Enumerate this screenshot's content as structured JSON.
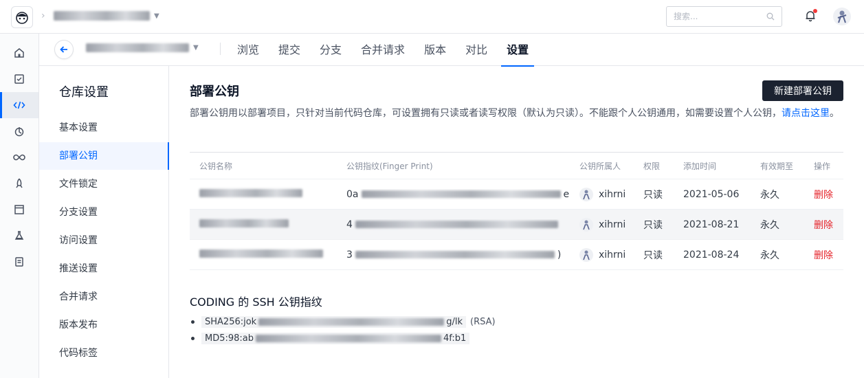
{
  "topbar": {
    "search_placeholder": "搜索...",
    "icons": {
      "logo": "coding-logo-icon",
      "search": "search-icon",
      "bell": "bell-icon"
    }
  },
  "leftnav": {
    "items": [
      "home-icon",
      "task-icon",
      "code-icon",
      "pipeline-icon",
      "infinity-icon",
      "deploy-icon",
      "artifact-icon",
      "test-icon",
      "wiki-icon"
    ]
  },
  "repo": {
    "tabs": [
      "浏览",
      "提交",
      "分支",
      "合并请求",
      "版本",
      "对比",
      "设置"
    ],
    "active_tab": "设置"
  },
  "settings_sidebar": {
    "title": "仓库设置",
    "items": [
      "基本设置",
      "部署公钥",
      "文件锁定",
      "分支设置",
      "访问设置",
      "推送设置",
      "合并请求",
      "版本发布",
      "代码标签"
    ],
    "active": "部署公钥"
  },
  "main": {
    "title": "部署公钥",
    "new_button": "新建部署公钥",
    "description": "部署公钥用以部署项目，只针对当前代码仓库，可设置拥有只读或者读写权限（默认为只读）。不能跟个人公钥通用，如需要设置个人公钥，",
    "description_link": "请点击这里",
    "description_end": "。",
    "table": {
      "headers": [
        "公钥名称",
        "公钥指纹(Finger Print)",
        "公钥所属人",
        "权限",
        "添加时间",
        "有效期至",
        "操作"
      ],
      "rows": [
        {
          "fp_prefix": "0a",
          "fp_suffix": "e",
          "owner": "xihrni",
          "permission": "只读",
          "added": "2021-05-06",
          "expires": "永久",
          "action": "删除"
        },
        {
          "fp_prefix": "4",
          "fp_suffix": "",
          "owner": "xihrni",
          "permission": "只读",
          "added": "2021-08-21",
          "expires": "永久",
          "action": "删除"
        },
        {
          "fp_prefix": "3",
          "fp_suffix": ")",
          "owner": "xihrni",
          "permission": "只读",
          "added": "2021-08-24",
          "expires": "永久",
          "action": "删除"
        }
      ]
    },
    "ssh_title": "CODING 的 SSH 公钥指纹",
    "fingerprints": [
      {
        "prefix": "SHA256:jok",
        "suffix": "g/lk",
        "note": "(RSA)"
      },
      {
        "prefix": "MD5:98:ab",
        "suffix": "4f:b1",
        "note": ""
      }
    ]
  }
}
